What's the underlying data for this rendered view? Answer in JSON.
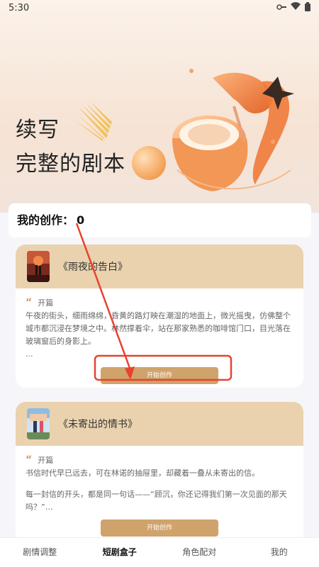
{
  "status": {
    "time": "5:30"
  },
  "hero": {
    "line1": "续写",
    "line2": "完整的剧本"
  },
  "creations": {
    "label": "我的创作：",
    "count": "0"
  },
  "stories": [
    {
      "title": "《雨夜的告白》",
      "section_label": "开篇",
      "excerpt": "午夜的街头，细雨绵绵，昏黄的路灯映在潮湿的地面上，微光摇曳，仿佛整个城市都沉浸在梦境之中。林然撑着伞，站在那家熟悉的咖啡馆门口，目光落在玻璃窗后的身影上。",
      "ellipsis": "...",
      "button": "开始创作"
    },
    {
      "title": "《未寄出的情书》",
      "section_label": "开篇",
      "excerpt": "书信时代早已远去，可在林诺的抽屉里，却藏着一叠从未寄出的信。",
      "excerpt2": "每一封信的开头，都是同一句话——“顾沉，你还记得我们第一次见面的那天吗？”…",
      "button": "开始创作"
    }
  ],
  "tabs": [
    "剧情调整",
    "短剧盒子",
    "角色配对",
    "我的"
  ],
  "active_tab": 1,
  "colors": {
    "accent": "#cfa36b",
    "card_header": "#ead2ae",
    "annotation": "#e8432d"
  }
}
